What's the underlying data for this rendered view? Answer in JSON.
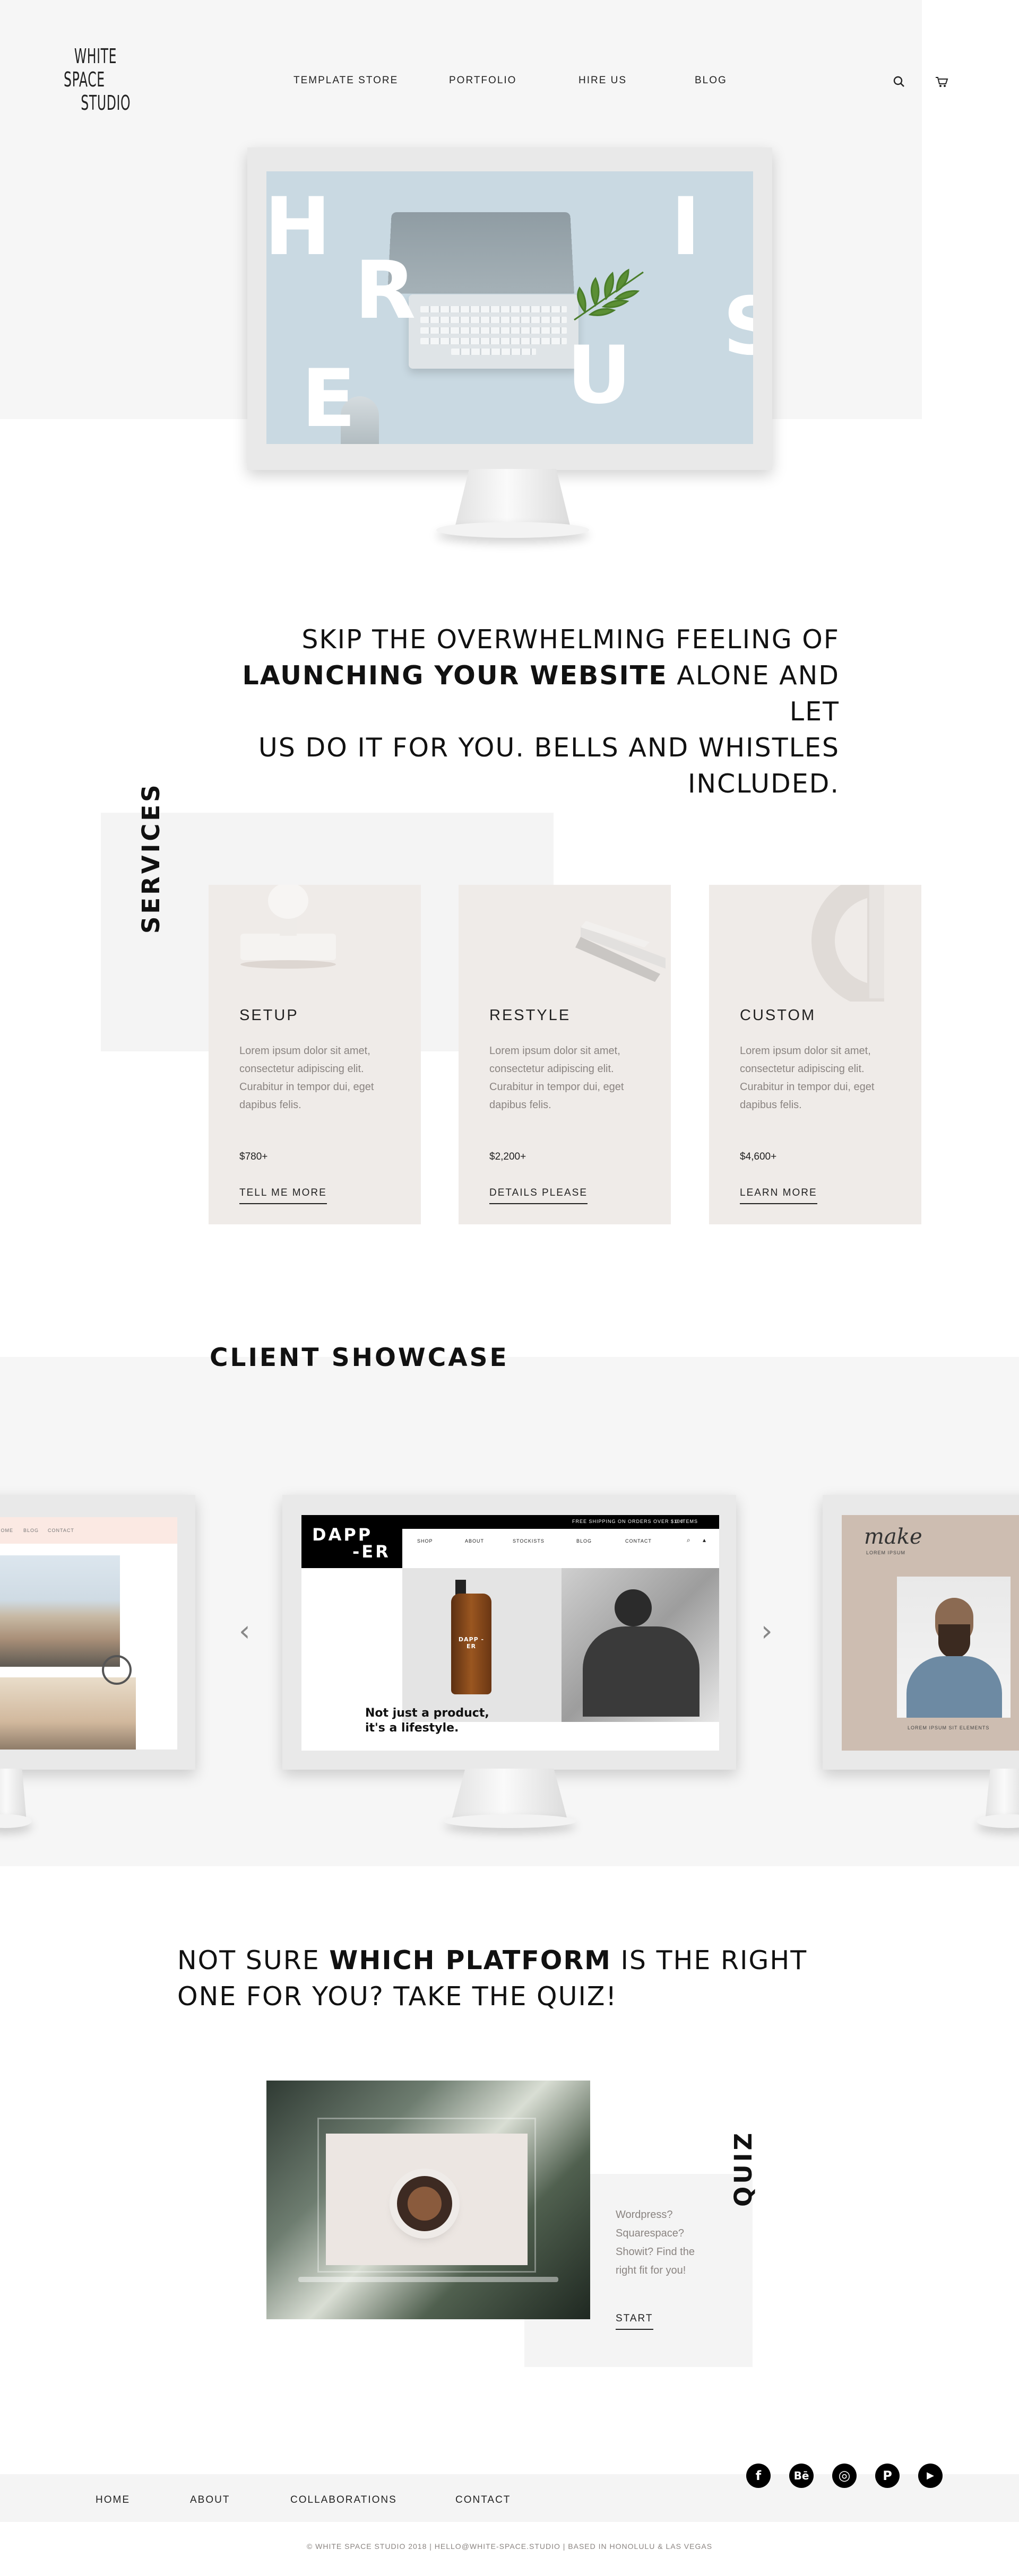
{
  "brand": {
    "logo_line1": "White",
    "logo_line2": "Space",
    "logo_line3": "Studio"
  },
  "nav": {
    "template_store": "TEMPLATE STORE",
    "portfolio": "PORTFOLIO",
    "hire_us": "HIRE US",
    "blog": "BLOG"
  },
  "hero": {
    "letters": [
      "H",
      "I",
      "R",
      "E",
      "U",
      "S"
    ]
  },
  "tagline": {
    "part1": "SKIP THE OVERWHELMING FEELING OF",
    "bold": "LAUNCHING YOUR WEBSITE",
    "part2": " ALONE AND LET",
    "part3": "US DO IT FOR YOU. BELLS AND WHISTLES",
    "part4": "INCLUDED."
  },
  "services": {
    "title": "SERVICES",
    "cards": [
      {
        "title": "SETUP",
        "description": "Lorem ipsum dolor sit amet, consectetur adipiscing elit. Curabitur in tempor dui, eget dapibus felis.",
        "price": "$780+",
        "link": "TELL ME MORE"
      },
      {
        "title": "RESTYLE",
        "description": "Lorem ipsum dolor sit amet, consectetur adipiscing elit. Curabitur in tempor dui, eget dapibus felis.",
        "price": "$2,200+",
        "link": "DETAILS PLEASE"
      },
      {
        "title": "CUSTOM",
        "description": "Lorem ipsum dolor sit amet, consectetur adipiscing elit. Curabitur in tempor dui, eget dapibus felis.",
        "price": "$4,600+",
        "link": "LEARN MORE"
      }
    ]
  },
  "showcase": {
    "title": "CLIENT SHOWCASE",
    "left_nav": [
      "HOME",
      "BLOG",
      "CONTACT"
    ],
    "dapper": {
      "logo_line1": "DAPP",
      "logo_line2": "-ER",
      "promo": "FREE SHIPPING ON ORDERS OVER $100",
      "cart": "0 ITEMS",
      "nav": [
        "SHOP",
        "ABOUT",
        "STOCKISTS",
        "BLOG",
        "CONTACT"
      ],
      "bottle_label": "DAPP -ER",
      "caption_line1": "Not just a product,",
      "caption_line2": "it's a lifestyle."
    },
    "right": {
      "script": "make",
      "sub": "LOREM IPSUM",
      "caption": "LOREM IPSUM SIT ELEMENTS"
    },
    "prev_arrow": "‹",
    "next_arrow": "›"
  },
  "quiz": {
    "heading_part1": "NOT SURE ",
    "heading_bold": "WHICH PLATFORM",
    "heading_part2": " IS THE RIGHT",
    "heading_line2": "ONE FOR YOU? TAKE THE QUIZ!",
    "title": "QUIZ",
    "text": "Wordpress? Squarespace? Showit? Find the right fit for you!",
    "start": "START"
  },
  "footer": {
    "links": [
      "HOME",
      "ABOUT",
      "COLLABORATIONS",
      "CONTACT"
    ],
    "social": [
      {
        "icon": "facebook-icon",
        "glyph": "f"
      },
      {
        "icon": "behance-icon",
        "glyph": "Bē"
      },
      {
        "icon": "instagram-icon",
        "glyph": "◎"
      },
      {
        "icon": "pinterest-icon",
        "glyph": "P"
      },
      {
        "icon": "youtube-icon",
        "glyph": "▶"
      }
    ],
    "copyright": "© WHITE SPACE STUDIO 2018 | HELLO@WHITE-SPACE.STUDIO | BASED IN HONOLULU & LAS VEGAS"
  }
}
